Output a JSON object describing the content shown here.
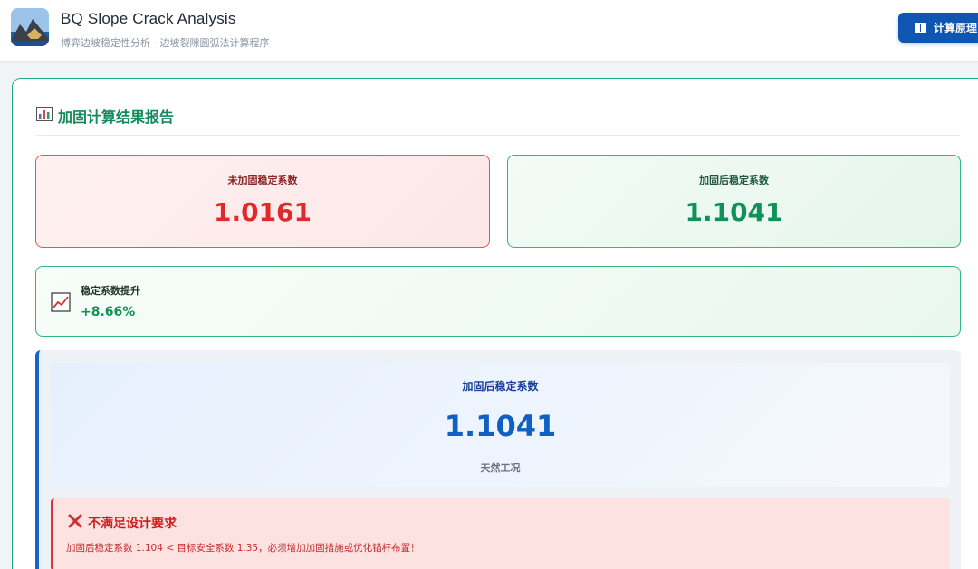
{
  "header": {
    "title": "BQ Slope Crack Analysis",
    "subtitle": "博弈边坡稳定性分析 · 边坡裂隙圆弧法计算程序",
    "principle_button": "计算原理",
    "logo_icon": "mountain-slope-logo",
    "principle_icon": "book-icon"
  },
  "report": {
    "title": "加固计算结果报告",
    "title_icon": "bar-chart-icon",
    "before": {
      "label": "未加固稳定系数",
      "value": "1.0161"
    },
    "after": {
      "label": "加固后稳定系数",
      "value": "1.1041"
    },
    "improvement": {
      "label": "稳定系数提升",
      "value": "+8.66%",
      "icon": "trend-up-icon"
    },
    "result": {
      "label": "加固后稳定系数",
      "value": "1.1041",
      "condition": "天然工况"
    },
    "warning": {
      "title": "不满足设计要求",
      "icon": "cross-mark-icon",
      "text": "加固后稳定系数 1.104 < 目标安全系数 1.35，必须增加加固措施或优化锚杆布置！"
    }
  },
  "colors": {
    "accent_green": "#1fae7a",
    "danger_red": "#df2a2a",
    "primary_blue": "#0f56b3"
  }
}
